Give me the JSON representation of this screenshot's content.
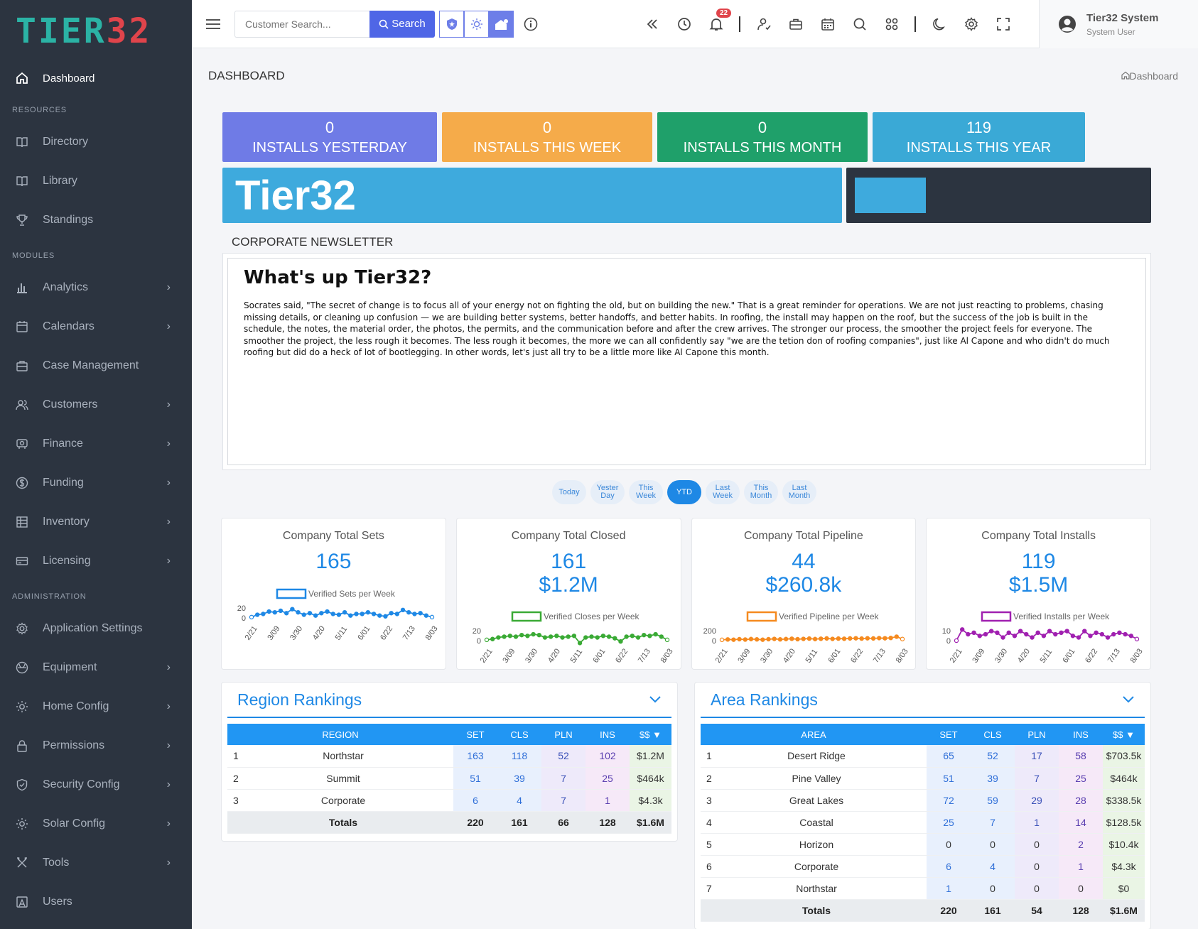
{
  "logo": {
    "part1": "TIER",
    "part2": "32"
  },
  "sidebar": {
    "dashboard": "Dashboard",
    "resources_title": "RESOURCES",
    "resources": [
      {
        "label": "Directory",
        "icon": "book-icon"
      },
      {
        "label": "Library",
        "icon": "book-icon"
      },
      {
        "label": "Standings",
        "icon": "trophy-icon"
      }
    ],
    "modules_title": "MODULES",
    "modules": [
      {
        "label": "Analytics",
        "icon": "bar-chart-icon",
        "chevron": true
      },
      {
        "label": "Calendars",
        "icon": "calendar-icon",
        "chevron": true
      },
      {
        "label": "Case Management",
        "icon": "briefcase-icon",
        "chevron": false
      },
      {
        "label": "Customers",
        "icon": "users-icon",
        "chevron": true
      },
      {
        "label": "Finance",
        "icon": "piggy-bank-icon",
        "chevron": true
      },
      {
        "label": "Funding",
        "icon": "dollar-icon",
        "chevron": true
      },
      {
        "label": "Inventory",
        "icon": "inventory-icon",
        "chevron": true
      },
      {
        "label": "Licensing",
        "icon": "card-icon",
        "chevron": true
      }
    ],
    "admin_title": "ADMINISTRATION",
    "admin": [
      {
        "label": "Application Settings",
        "icon": "gear-icon",
        "chevron": false
      },
      {
        "label": "Equipment",
        "icon": "equipment-icon",
        "chevron": true
      },
      {
        "label": "Home Config",
        "icon": "sun-icon",
        "chevron": true
      },
      {
        "label": "Permissions",
        "icon": "lock-icon",
        "chevron": true
      },
      {
        "label": "Security Config",
        "icon": "shield-icon",
        "chevron": true
      },
      {
        "label": "Solar Config",
        "icon": "sun-icon",
        "chevron": true
      },
      {
        "label": "Tools",
        "icon": "tools-icon",
        "chevron": true
      },
      {
        "label": "Users",
        "icon": "user-box-icon",
        "chevron": false
      }
    ],
    "chevron_glyph": "›"
  },
  "topbar": {
    "search_placeholder": "Customer Search...",
    "search_label": "Search",
    "notification_count": "22"
  },
  "user": {
    "name": "Tier32 System",
    "role": "System User"
  },
  "page": {
    "title": "DASHBOARD",
    "breadcrumb": "Dashboard"
  },
  "stats": [
    {
      "value": "0",
      "label": "INSTALLS YESTERDAY",
      "color": "#6f7be6"
    },
    {
      "value": "0",
      "label": "INSTALLS THIS WEEK",
      "color": "#f5ab4a"
    },
    {
      "value": "0",
      "label": "INSTALLS THIS MONTH",
      "color": "#1fa06a"
    },
    {
      "value": "119",
      "label": "INSTALLS THIS YEAR",
      "color": "#3aa9d6"
    }
  ],
  "banner": {
    "text": "Tier32"
  },
  "newsletter": {
    "section_title": "CORPORATE NEWSLETTER",
    "heading": "What's up Tier32?",
    "body": "Socrates said, \"The secret of change is to focus all of your energy not on fighting the old, but on building the new.\" That is a great reminder for operations. We are not just reacting to problems, chasing missing details, or cleaning up confusion — we are building better systems, better handoffs, and better habits. In roofing, the install may happen on the roof, but the success of the job is built in the schedule, the notes, the material order, the photos, the permits, and the communication before and after the crew arrives. The stronger our process, the smoother the project feels for everyone. The smoother the project, the less rough it becomes. The less rough it becomes, the more we can all confidently say \"we are the tetion don of roofing companies\", just like Al Capone and who didn't do much roofing but did do a heck of lot of bootlegging. In other words, let's just all try to be a little more like Al Capone this month."
  },
  "periods": [
    {
      "label": "Today",
      "active": false
    },
    {
      "label": "Yester Day",
      "active": false
    },
    {
      "label": "This Week",
      "active": false
    },
    {
      "label": "YTD",
      "active": true
    },
    {
      "label": "Last Week",
      "active": false
    },
    {
      "label": "This Month",
      "active": false
    },
    {
      "label": "Last Month",
      "active": false
    }
  ],
  "kpis": [
    {
      "title": "Company Total Sets",
      "value": "165",
      "amount": "",
      "legend": "Verified Sets per Week",
      "color": "#1e88e5"
    },
    {
      "title": "Company Total Closed",
      "value": "161",
      "amount": "$1.2M",
      "legend": "Verified Closes per Week",
      "color": "#3aaa35"
    },
    {
      "title": "Company Total Pipeline",
      "value": "44",
      "amount": "$260.8k",
      "legend": "Verified Pipeline per Week",
      "color": "#f58a1f"
    },
    {
      "title": "Company Total Installs",
      "value": "119",
      "amount": "$1.5M",
      "legend": "Verified Installs per Week",
      "color": "#a020b0"
    }
  ],
  "chart_data": [
    {
      "type": "line",
      "x": [
        "2/21",
        "3/09",
        "3/30",
        "4/20",
        "5/11",
        "6/01",
        "6/22",
        "7/13",
        "8/03"
      ],
      "yticks": [
        "20",
        "0"
      ],
      "ylim": [
        0,
        20
      ],
      "series": [
        {
          "name": "Verified Sets per Week",
          "values": [
            1,
            4,
            5,
            8,
            7,
            9,
            6,
            11,
            7,
            4,
            6,
            3,
            6,
            8,
            5,
            4,
            7,
            3,
            5,
            5,
            7,
            5,
            3,
            2,
            6,
            5,
            10,
            7,
            5,
            6,
            3,
            1
          ]
        }
      ]
    },
    {
      "type": "line",
      "x": [
        "2/21",
        "3/09",
        "3/30",
        "4/20",
        "5/11",
        "6/01",
        "6/22",
        "7/13",
        "8/03"
      ],
      "yticks": [
        "20",
        "0"
      ],
      "ylim": [
        0,
        20
      ],
      "series": [
        {
          "name": "Verified Closes per Week",
          "values": [
            1,
            2,
            4,
            5,
            6,
            5,
            7,
            6,
            8,
            7,
            4,
            5,
            6,
            4,
            5,
            6,
            -3,
            4,
            5,
            4,
            6,
            5,
            3,
            -1,
            5,
            6,
            4,
            7,
            6,
            8,
            5,
            1
          ]
        }
      ]
    },
    {
      "type": "line",
      "x": [
        "2/21",
        "3/09",
        "3/30",
        "4/20",
        "5/11",
        "6/01",
        "6/22",
        "7/13",
        "8/03"
      ],
      "yticks": [
        "200",
        "0"
      ],
      "ylim": [
        0,
        200
      ],
      "series": [
        {
          "name": "Verified Pipeline per Week",
          "values": [
            10,
            15,
            12,
            18,
            14,
            20,
            16,
            12,
            18,
            22,
            16,
            20,
            24,
            18,
            22,
            26,
            20,
            24,
            28,
            22,
            26,
            24,
            28,
            30,
            26,
            30,
            28,
            32,
            30,
            34,
            50,
            20
          ]
        }
      ]
    },
    {
      "type": "line",
      "x": [
        "2/21",
        "3/09",
        "3/30",
        "4/20",
        "5/11",
        "6/01",
        "6/22",
        "7/13",
        "8/03"
      ],
      "yticks": [
        "10",
        "0"
      ],
      "ylim": [
        0,
        10
      ],
      "series": [
        {
          "name": "Verified Installs per Week",
          "values": [
            0,
            7,
            4,
            5,
            3,
            4,
            6,
            5,
            2,
            5,
            3,
            6,
            4,
            2,
            5,
            3,
            6,
            4,
            5,
            6,
            3,
            2,
            6,
            3,
            5,
            4,
            2,
            4,
            5,
            4,
            3,
            1
          ]
        }
      ]
    }
  ],
  "region_rankings": {
    "title": "Region Rankings",
    "headers": [
      "REGION",
      "SET",
      "CLS",
      "PLN",
      "INS",
      "$$ ▼"
    ],
    "rows": [
      {
        "rank": "1",
        "name": "Northstar",
        "set": "163",
        "cls": "118",
        "pln": "52",
        "ins": "102",
        "amt": "$1.2M"
      },
      {
        "rank": "2",
        "name": "Summit",
        "set": "51",
        "cls": "39",
        "pln": "7",
        "ins": "25",
        "amt": "$464k"
      },
      {
        "rank": "3",
        "name": "Corporate",
        "set": "6",
        "cls": "4",
        "pln": "7",
        "ins": "1",
        "amt": "$4.3k"
      }
    ],
    "totals": {
      "label": "Totals",
      "set": "220",
      "cls": "161",
      "pln": "66",
      "ins": "128",
      "amt": "$1.6M"
    }
  },
  "area_rankings": {
    "title": "Area Rankings",
    "headers": [
      "AREA",
      "SET",
      "CLS",
      "PLN",
      "INS",
      "$$ ▼"
    ],
    "rows": [
      {
        "rank": "1",
        "name": "Desert Ridge",
        "set": "65",
        "cls": "52",
        "pln": "17",
        "ins": "58",
        "amt": "$703.5k"
      },
      {
        "rank": "2",
        "name": "Pine Valley",
        "set": "51",
        "cls": "39",
        "pln": "7",
        "ins": "25",
        "amt": "$464k"
      },
      {
        "rank": "3",
        "name": "Great Lakes",
        "set": "72",
        "cls": "59",
        "pln": "29",
        "ins": "28",
        "amt": "$338.5k"
      },
      {
        "rank": "4",
        "name": "Coastal",
        "set": "25",
        "cls": "7",
        "pln": "1",
        "ins": "14",
        "amt": "$128.5k"
      },
      {
        "rank": "5",
        "name": "Horizon",
        "set": "0",
        "cls": "0",
        "pln": "0",
        "ins": "2",
        "amt": "$10.4k"
      },
      {
        "rank": "6",
        "name": "Corporate",
        "set": "6",
        "cls": "4",
        "pln": "0",
        "ins": "1",
        "amt": "$4.3k"
      },
      {
        "rank": "7",
        "name": "Northstar",
        "set": "1",
        "cls": "0",
        "pln": "0",
        "ins": "0",
        "amt": "$0"
      }
    ],
    "totals": {
      "label": "Totals",
      "set": "220",
      "cls": "161",
      "pln": "54",
      "ins": "128",
      "amt": "$1.6M"
    }
  }
}
